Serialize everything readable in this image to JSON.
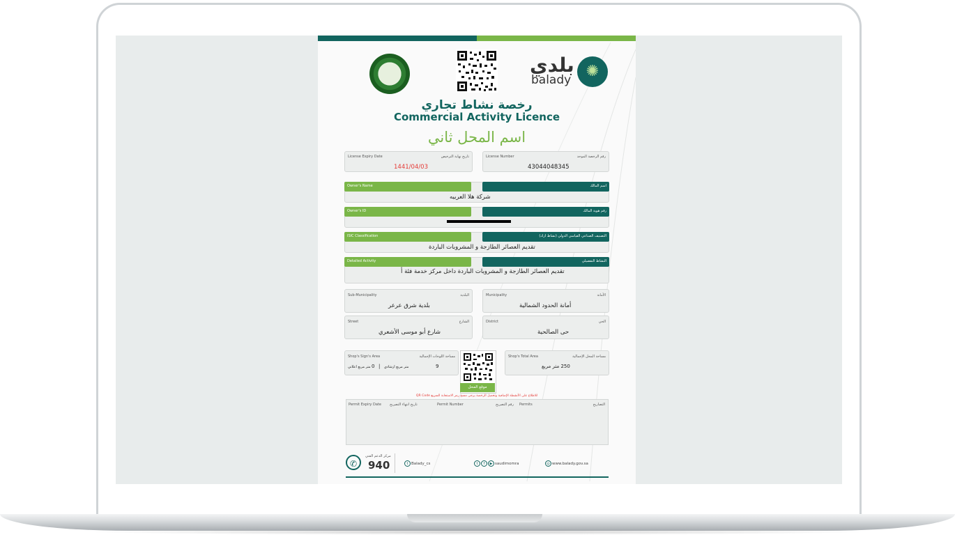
{
  "licence": {
    "title_ar": "رخصة نشاط تجاري",
    "title_en": "Commercial Activity Licence",
    "shop_name": "اسم المحل ثاني",
    "logo_ar": "بلدي",
    "logo_en": "balady",
    "expiry": {
      "label_en": "License Expiry Date",
      "label_ar": "تاريخ نهاية الترخيص",
      "value": "1441/04/03"
    },
    "number": {
      "label_en": "License Number",
      "label_ar": "رقم الرخصة الموحد",
      "value": "43044048345"
    },
    "owner_name": {
      "label_en": "Owner's Name",
      "label_ar": "اسم المالك",
      "value": "شركة هلا العربيه"
    },
    "owner_id": {
      "label_en": "Owner's ID",
      "label_ar": "رقم هوية المالك"
    },
    "isic": {
      "label_en": "ISIC Classification",
      "label_ar": "التصنيف الصناعي القياسي الدولي (نشاط ازك)",
      "value": "تقديم العصائر الطازجة و المشروبات الباردة"
    },
    "detailed": {
      "label_en": "Detailed Activity",
      "label_ar": "النشاط التفصيلي",
      "value": "تقديم العصائر الطازجة و المشروبات الباردة  داخل مركز خدمة فئة أ"
    },
    "sub_municipality": {
      "label_en": "Sub-Municipality",
      "label_ar": "البلدية",
      "value": "بلدية شرق عرعر"
    },
    "municipality": {
      "label_en": "Municipality",
      "label_ar": "الأمانة",
      "value": "أمانة الحدود الشمالية"
    },
    "street": {
      "label_en": "Street",
      "label_ar": "الشارع",
      "value": "شارع أبو موسى الأشعري"
    },
    "district": {
      "label_en": "District",
      "label_ar": "الحي",
      "value": "حى الصالحية"
    },
    "sign_area": {
      "label_en": "Shop's Sign's Area",
      "label_ar": "مساحة اللوحات الإجمالية",
      "value_a": "9",
      "unit_a": "متر مربع ارشادي",
      "sep": "|",
      "value_b": "0",
      "unit_b": "متر مربع اعلاني"
    },
    "total_area": {
      "label_en": "Shop's Total Area",
      "label_ar": "مساحة المحل الإجمالية",
      "value": "250 متر مربع"
    },
    "qr_label": "موقع المحل",
    "note": "للاطلاع على الأنشطة الإضافية وتحميل الرخصة يرجى مسح رمز الاستجابة السريع QR Code",
    "permits_headers": {
      "expiry_en": "Permit Expiry Date",
      "expiry_ar": "تاريخ انتهاء التصريح",
      "number_en": "Permit Number",
      "number_ar": "رقم التصريح",
      "permits_en": "Permits",
      "permits_ar": "التصاريح"
    },
    "footer": {
      "support_label": "مركز الدعم الفني",
      "support_number": "940",
      "twitter": "Balady_cs",
      "social": "saudimomra",
      "website": "www.balady.gov.sa"
    }
  },
  "colors": {
    "teal": "#12655f",
    "green": "#7ab648",
    "red": "#e53935"
  }
}
